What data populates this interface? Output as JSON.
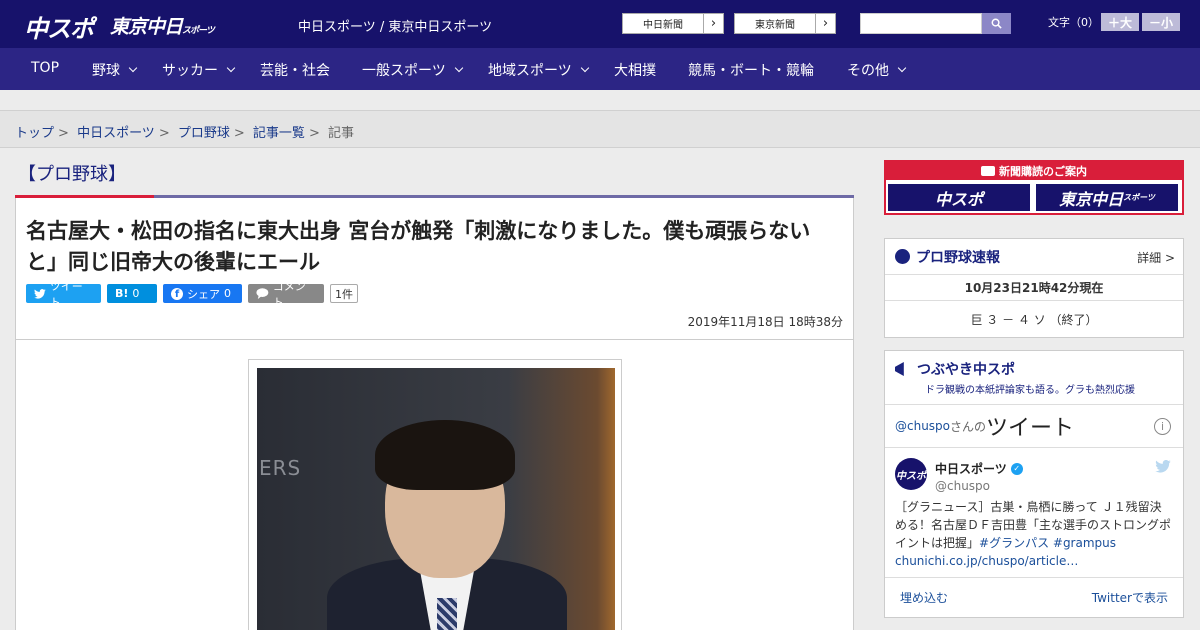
{
  "header": {
    "logo_chuspo": "中スポ",
    "logo_tokyo": "東京中日",
    "logo_tokyo_small": "スポーツ",
    "site_names": "中日スポーツ / 東京中日スポーツ",
    "ext_links": [
      "中日新聞",
      "東京新聞"
    ],
    "search_placeholder": "",
    "font_label": "文字（0）",
    "font_up": "＋大",
    "font_down": "－小"
  },
  "nav": {
    "items": [
      {
        "label": "TOP"
      },
      {
        "label": "野球"
      },
      {
        "label": "サッカー"
      },
      {
        "label": "芸能・社会"
      },
      {
        "label": "一般スポーツ"
      },
      {
        "label": "地域スポーツ"
      },
      {
        "label": "大相撲"
      },
      {
        "label": "競馬・ボート・競輪"
      },
      {
        "label": "その他"
      }
    ]
  },
  "breadcrumb": [
    "トップ",
    "中日スポーツ",
    "プロ野球",
    "記事一覧",
    "記事"
  ],
  "article": {
    "category": "【プロ野球】",
    "headline": "名古屋大・松田の指名に東大出身 宮台が触発「刺激になりました。僕も頑張らないと」同じ旧帝大の後輩にエール",
    "share": {
      "tweet": "ツイート",
      "hatena": "B!",
      "hatena_count": "0",
      "facebook": "シェア",
      "facebook_count": "0",
      "comment": "コメント",
      "comment_count": "1件"
    },
    "date": "2019年11月18日 18時38分",
    "photo_text": "ERS"
  },
  "sidebar": {
    "banner_top": "新聞購読のご案内",
    "banner_left": "中スポ",
    "banner_right": "東京中日",
    "banner_right_small": "スポーツ",
    "score": {
      "title": "プロ野球速報",
      "more": "詳細 >",
      "timestamp": "10月23日21時42分現在",
      "line": "巨 ３ － ４ ソ （終了）"
    },
    "tweets": {
      "title": "つぶやき中スポ",
      "subtitle": "ドラ観戦の本紙評論家も語る。グラも熱烈応援",
      "handle_link": "@chuspo",
      "san_no": "さんの",
      "tweet_word": "ツイート",
      "user_name": "中日スポーツ",
      "user_handle": "@chuspo",
      "text": "［グラニュース］古巣・鳥栖に勝って Ｊ１残留決める！名古屋ＤＦ吉田豊「主な選手のストロングポイントは把握」",
      "tags": "#グランパス #grampus",
      "link": "chunichi.co.jp/chuspo/article…",
      "embed": "埋め込む",
      "view_on_twitter": "Twitterで表示"
    }
  }
}
